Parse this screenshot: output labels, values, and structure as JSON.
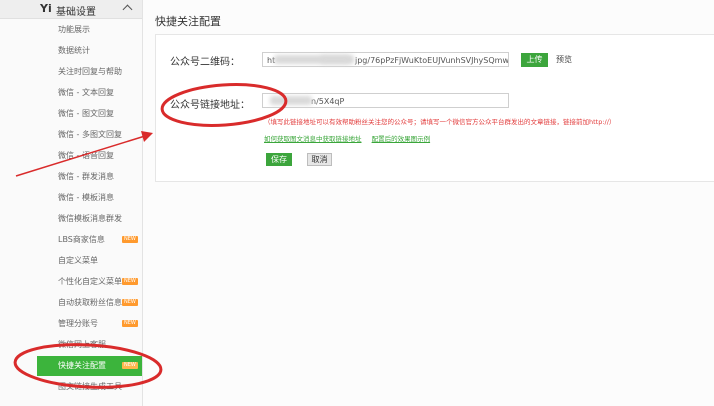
{
  "sidebar": {
    "logo": "Yi",
    "title": "基础设置",
    "items": [
      {
        "label": "功能展示",
        "badge": ""
      },
      {
        "label": "数据统计",
        "badge": ""
      },
      {
        "label": "关注时回复与帮助",
        "badge": ""
      },
      {
        "label": "微信 - 文本回复",
        "badge": ""
      },
      {
        "label": "微信 - 图文回复",
        "badge": ""
      },
      {
        "label": "微信 - 多图文回复",
        "badge": ""
      },
      {
        "label": "微信 - 语音回复",
        "badge": ""
      },
      {
        "label": "微信 - 群发消息",
        "badge": ""
      },
      {
        "label": "微信 - 模板消息",
        "badge": ""
      },
      {
        "label": "微信模板消息群发",
        "badge": ""
      },
      {
        "label": "LBS商家信息",
        "badge": "NEW"
      },
      {
        "label": "自定义菜单",
        "badge": ""
      },
      {
        "label": "个性化自定义菜单",
        "badge": "NEW"
      },
      {
        "label": "自动获取粉丝信息",
        "badge": "NEW"
      },
      {
        "label": "管理分账号",
        "badge": "NEW"
      },
      {
        "label": "微信网上客服",
        "badge": ""
      },
      {
        "label": "快捷关注配置",
        "badge": "NEW",
        "active": true
      },
      {
        "label": "图文链接生成工具",
        "badge": ""
      }
    ]
  },
  "main": {
    "page_title": "快捷关注配置",
    "qr_label": "公众号二维码：",
    "qr_value_visible": "ht",
    "qr_value_suffix": "jpg/76pPzFjWuKtoEUJVunhSVJhySQmw",
    "upload_label": "上传",
    "preview_label": "预览",
    "link_label": "公众号链接地址：",
    "link_value_suffix": "n/5X4qP",
    "hint": "（填写此链接地址可以有效帮助粉丝关注您的公众号；请填写一个微信官方公众平台群发出的文章链接，链接前加http://）",
    "link_help_1": "如何获取图文消息中获取链接地址",
    "link_help_2": "配置后的效果图示例",
    "save_label": "保存",
    "cancel_label": "取消"
  },
  "colors": {
    "accent_green": "#3ca53c",
    "annotation_red": "#d92b2b",
    "badge_orange": "#ff9a2e"
  }
}
